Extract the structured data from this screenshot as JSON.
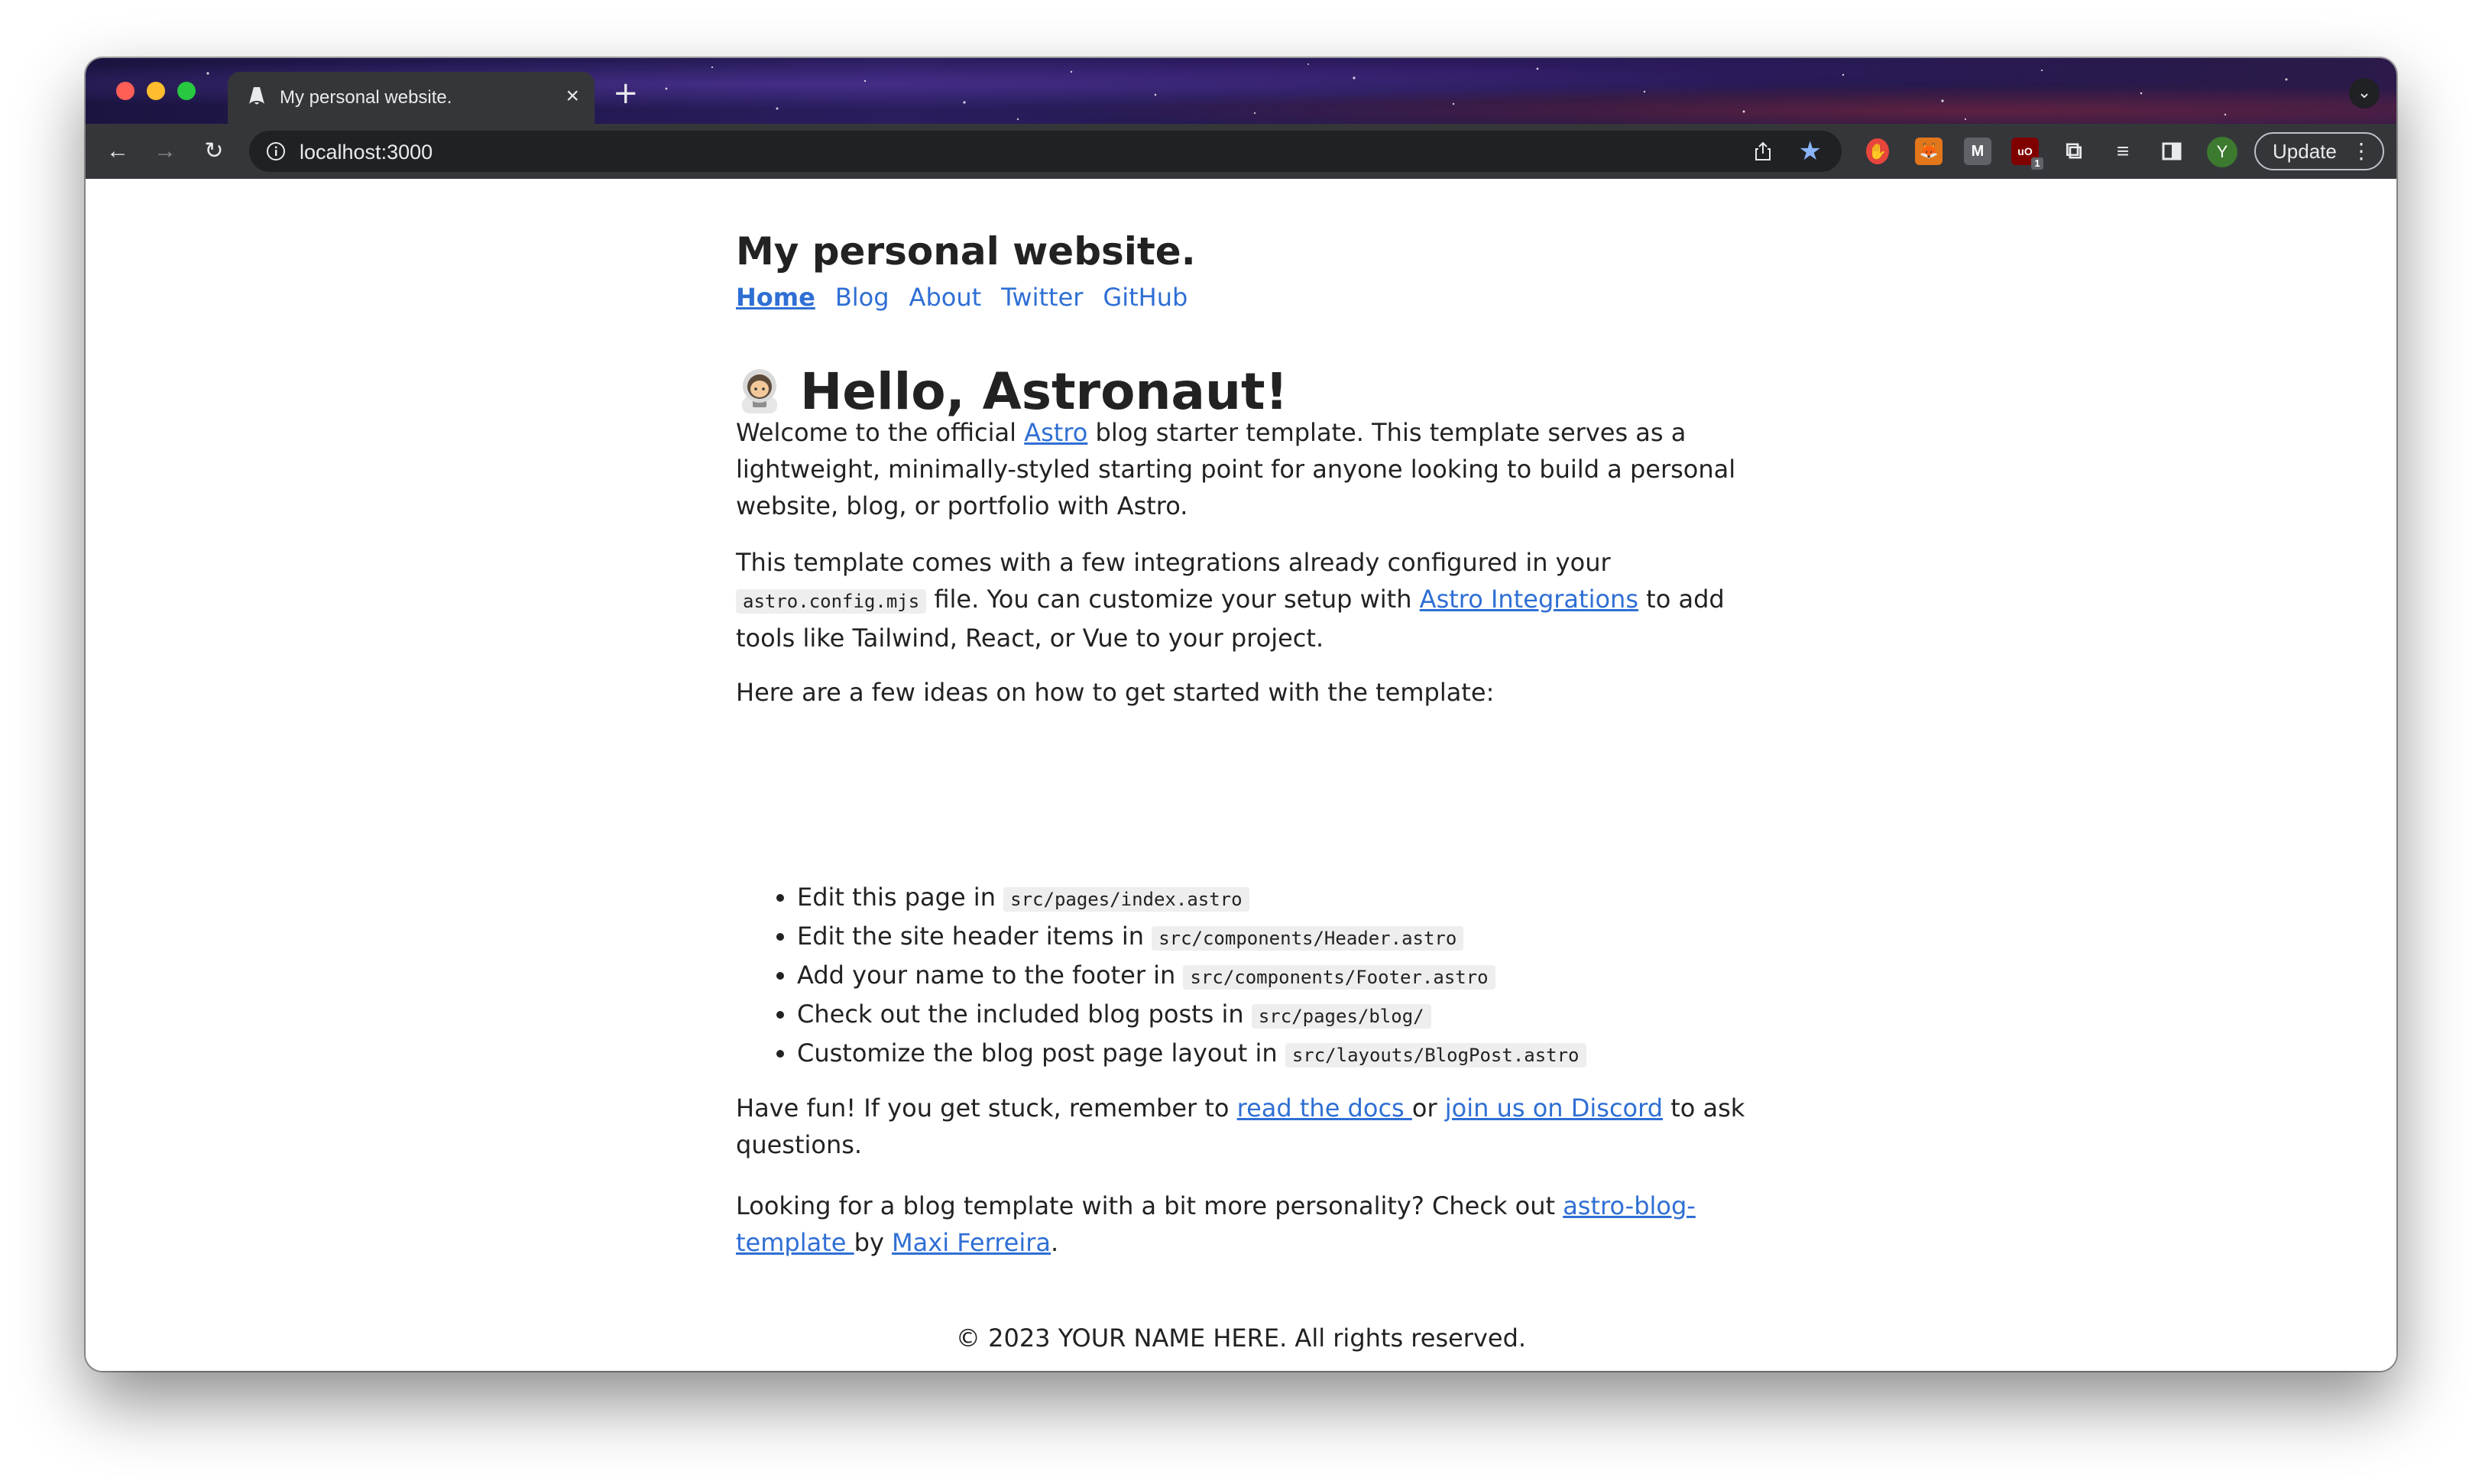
{
  "browser": {
    "tab_title": "My personal website.",
    "tab_close": "×",
    "new_tab": "+",
    "url": "localhost:3000",
    "avatar_letter": "Y",
    "update_label": "Update",
    "ext_badge": "1",
    "ext_ub_label": "uO",
    "ext_m_label": "M",
    "accent_color": "#8ab4f8",
    "avatar_color": "#3c7a2f"
  },
  "site": {
    "title": "My personal website.",
    "nav": {
      "home": "Home",
      "blog": "Blog",
      "about": "About",
      "twitter": "Twitter",
      "github": "GitHub"
    },
    "link_color": "#2f6fd4"
  },
  "main": {
    "heading": "Hello, Astronaut!",
    "p1": {
      "t1": "Welcome to the official ",
      "link": "Astro",
      "t2": " blog starter template. This template serves as a lightweight, minimally-styled starting point for anyone looking to build a personal website, blog, or portfolio with Astro."
    },
    "p2": {
      "t1": "This template comes with a few integrations already configured in your ",
      "code": "astro.config.mjs",
      "t2": " file. You can customize your setup with ",
      "link": "Astro Integrations",
      "t3": " to add tools like Tailwind, React, or Vue to your project."
    },
    "p3": "Here are a few ideas on how to get started with the template:",
    "ideas": [
      {
        "text": "Edit this page in ",
        "code": "src/pages/index.astro"
      },
      {
        "text": "Edit the site header items in ",
        "code": "src/components/Header.astro"
      },
      {
        "text": "Add your name to the footer in ",
        "code": "src/components/Footer.astro"
      },
      {
        "text": "Check out the included blog posts in ",
        "code": "src/pages/blog/"
      },
      {
        "text": "Customize the blog post page layout in ",
        "code": "src/layouts/BlogPost.astro"
      }
    ],
    "p4": {
      "t1": "Have fun! If you get stuck, remember to ",
      "link1": "read the docs ",
      "t2": "or ",
      "link2": "join us on Discord",
      "t3": " to ask questions."
    },
    "p5": {
      "t1": "Looking for a blog template with a bit more personality? Check out ",
      "link1": "astro-blog-template ",
      "t2": "by ",
      "link2": "Maxi Ferreira",
      "t3": "."
    }
  },
  "footer": {
    "text": "© 2023 YOUR NAME HERE. All rights reserved."
  }
}
